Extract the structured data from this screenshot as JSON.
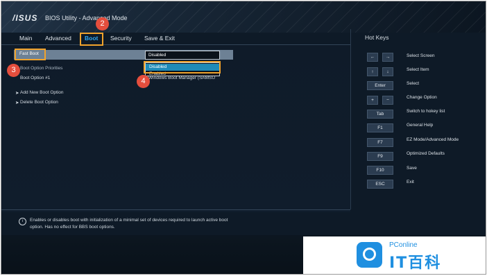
{
  "header": {
    "logo": "/ISUS",
    "title": "BIOS Utility - Advanced Mode"
  },
  "tabs": [
    {
      "label": "Main"
    },
    {
      "label": "Advanced"
    },
    {
      "label": "Boot",
      "active": true
    },
    {
      "label": "Security"
    },
    {
      "label": "Save & Exit"
    }
  ],
  "settings": {
    "fast_boot": {
      "label": "Fast Boot",
      "value": "Disabled"
    },
    "boot_priorities_label": "Boot Option Priorities",
    "boot_option_1": {
      "label": "Boot Option #1",
      "value": "Windows Boot Manager (SAMSU"
    },
    "add_new_boot_option": "Add New Boot Option",
    "delete_boot_option": "Delete Boot Option"
  },
  "dropdown": {
    "options": [
      "Disabled",
      "Enabled"
    ],
    "selected": "Disabled"
  },
  "help": {
    "info_icon": "info-icon",
    "text": "Enables or disables boot with initialization of a minimal set of devices required to launch active boot option. Has no effect for BBS boot options."
  },
  "hotkeys": {
    "title": "Hot Keys",
    "items": [
      {
        "keys": [
          "←",
          "→"
        ],
        "description": "Select Screen"
      },
      {
        "keys": [
          "↑",
          "↓"
        ],
        "description": "Select Item"
      },
      {
        "keys": [
          "Enter"
        ],
        "description": "Select"
      },
      {
        "keys": [
          "+",
          "−"
        ],
        "description": "Change Option"
      },
      {
        "keys": [
          "Tab"
        ],
        "description": "Switch to hokey list"
      },
      {
        "keys": [
          "F1"
        ],
        "description": "General Help"
      },
      {
        "keys": [
          "F7"
        ],
        "description": "EZ Mode/Advanced Mode"
      },
      {
        "keys": [
          "F9"
        ],
        "description": "Optimized Defaults"
      },
      {
        "keys": [
          "F10"
        ],
        "description": "Save"
      },
      {
        "keys": [
          "ESC"
        ],
        "description": "Exit"
      }
    ]
  },
  "annotations": {
    "step2": "2",
    "step3": "3",
    "step4": "4"
  },
  "watermark": {
    "small": "PConline",
    "big": "IT百科"
  },
  "colors": {
    "highlight": "#f1a32c",
    "active_tab": "#2fa9f5",
    "badge": "#e54e3d",
    "selected_option": "#1e8bb8"
  }
}
